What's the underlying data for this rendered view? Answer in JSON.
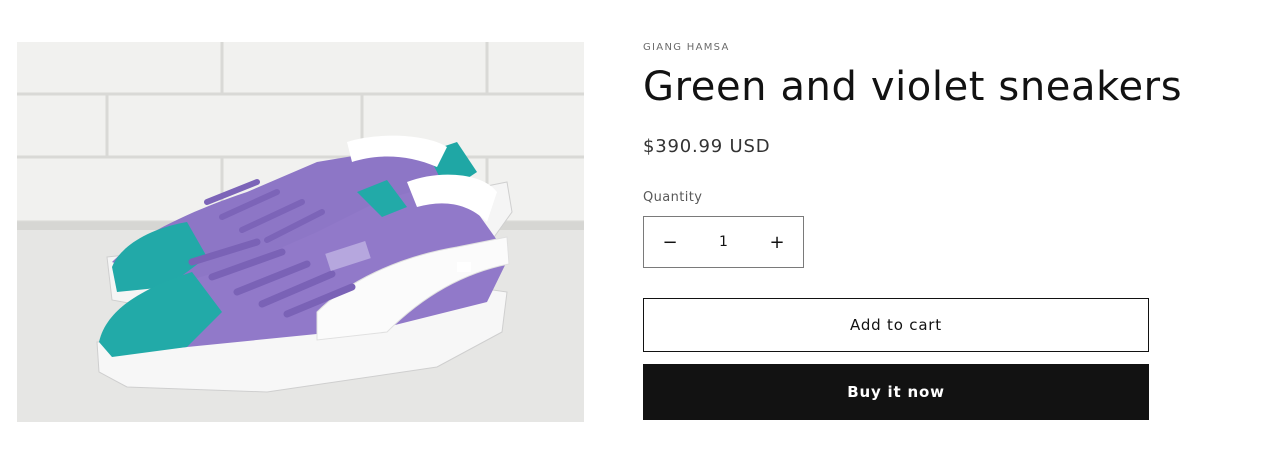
{
  "product": {
    "vendor": "GIANG HAMSA",
    "title": "Green and violet sneakers",
    "price": "$390.99 USD",
    "image_alt": "Green and violet sneakers"
  },
  "quantity": {
    "label": "Quantity",
    "value": "1",
    "decrease_icon": "−",
    "increase_icon": "+"
  },
  "actions": {
    "add_to_cart": "Add to cart",
    "buy_now": "Buy it now"
  },
  "colors": {
    "primary": "#121212",
    "shoe_upper": "#9179c9",
    "shoe_toe": "#22aaa8"
  }
}
